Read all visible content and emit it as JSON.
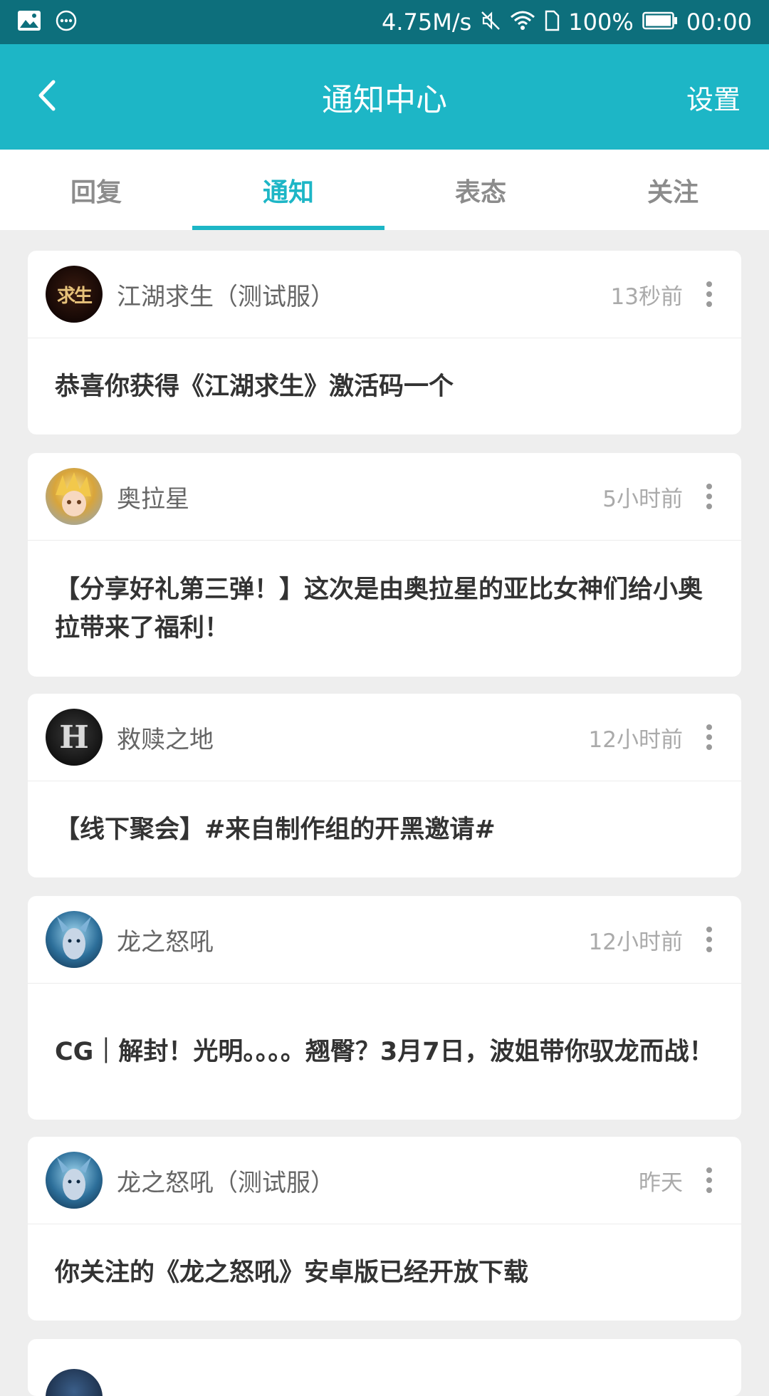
{
  "status_bar": {
    "speed": "4.75M/s",
    "battery": "100%",
    "time": "00:00",
    "icons": [
      "image-icon",
      "chat-bubble-icon",
      "mute-icon",
      "wifi-icon",
      "sim-icon",
      "battery-icon"
    ]
  },
  "header": {
    "title": "通知中心",
    "settings_label": "设置",
    "back_icon": "back-arrow-icon",
    "color": "#1db6c6"
  },
  "tabs": [
    {
      "label": "回复",
      "active": false
    },
    {
      "label": "通知",
      "active": true
    },
    {
      "label": "表态",
      "active": false
    },
    {
      "label": "关注",
      "active": false
    }
  ],
  "notifications": [
    {
      "name": "江湖求生（测试服）",
      "time": "13秒前",
      "message": "恭喜你获得《江湖求生》激活码一个",
      "avatar_glyph": "求生"
    },
    {
      "name": "奥拉星",
      "time": "5小时前",
      "message": "【分享好礼第三弹！】这次是由奥拉星的亚比女神们给小奥拉带来了福利！",
      "avatar_glyph": ""
    },
    {
      "name": "救赎之地",
      "time": "12小时前",
      "message": "【线下聚会】#来自制作组的开黑邀请#",
      "avatar_glyph": "H"
    },
    {
      "name": "龙之怒吼",
      "time": "12小时前",
      "message": "CG｜解封！光明。。。。翘臀？3月7日，波姐带你驭龙而战！",
      "avatar_glyph": ""
    },
    {
      "name": "龙之怒吼（测试服）",
      "time": "昨天",
      "message": "你关注的《龙之怒吼》安卓版已经开放下载",
      "avatar_glyph": ""
    }
  ]
}
